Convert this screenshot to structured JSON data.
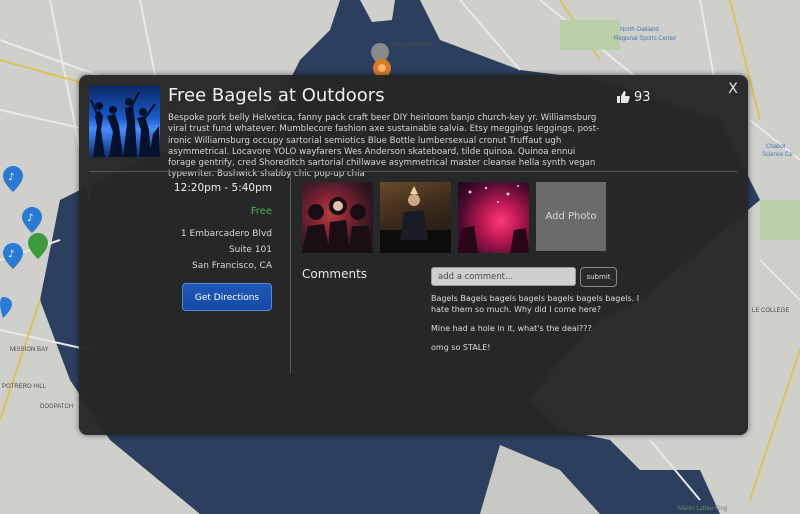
{
  "map": {
    "labels": {
      "golden_gate": "GOLDEN GATE",
      "north_oakland": "North Oakland",
      "regional_sports": "Regional Sports Center",
      "mission_bay": "MISSION BAY",
      "potrero_hill": "POTRERO HILL",
      "dogpatch": "DOGPATCH",
      "chabot": "Chabot",
      "science": "Science Ce",
      "le_college": "LE COLLEGE",
      "martin_luther_king": "Martin Luther King"
    }
  },
  "event": {
    "title": "Free Bagels at Outdoors",
    "likes": "93",
    "description": "Bespoke pork belly Helvetica, fanny pack craft beer DIY heirloom banjo church-key yr. Williamsburg viral trust fund whatever. Mumblecore fashion axe sustainable salvia. Etsy meggings leggings, post-ironic Williamsburg occupy sartorial semiotics Blue Bottle lumbersexual cronut Truffaut ugh asymmetrical. Locavore YOLO wayfarers Wes Anderson skateboard, tilde quinoa. Quinoa ennui forage gentrify, cred Shoreditch sartorial chillwave asymmetrical master cleanse hella synth vegan typewriter. Bushwick shabby chic pop-up chia",
    "time_range": "12:20pm - 5:40pm",
    "price": "Free",
    "address_line1": "1 Embarcadero Blvd",
    "address_line2": "Suite 101",
    "address_line3": "San Francisco, CA",
    "directions_label": "Get Directions",
    "close_label": "X"
  },
  "photos": {
    "add_photo_label": "Add Photo"
  },
  "comments": {
    "heading": "Comments",
    "input_placeholder": "add a comment...",
    "submit_label": "submit",
    "items": [
      "Bagels Bagels bagels bagels bagels bagels bagels. I hate them so much. Why did I come here?",
      "Mine had a hole in it, what's the deal???",
      "omg so STALE!"
    ]
  },
  "colors": {
    "price_green": "#4fb04f",
    "directions_blue": "#1f57b8",
    "modal_bg": "#262626"
  }
}
